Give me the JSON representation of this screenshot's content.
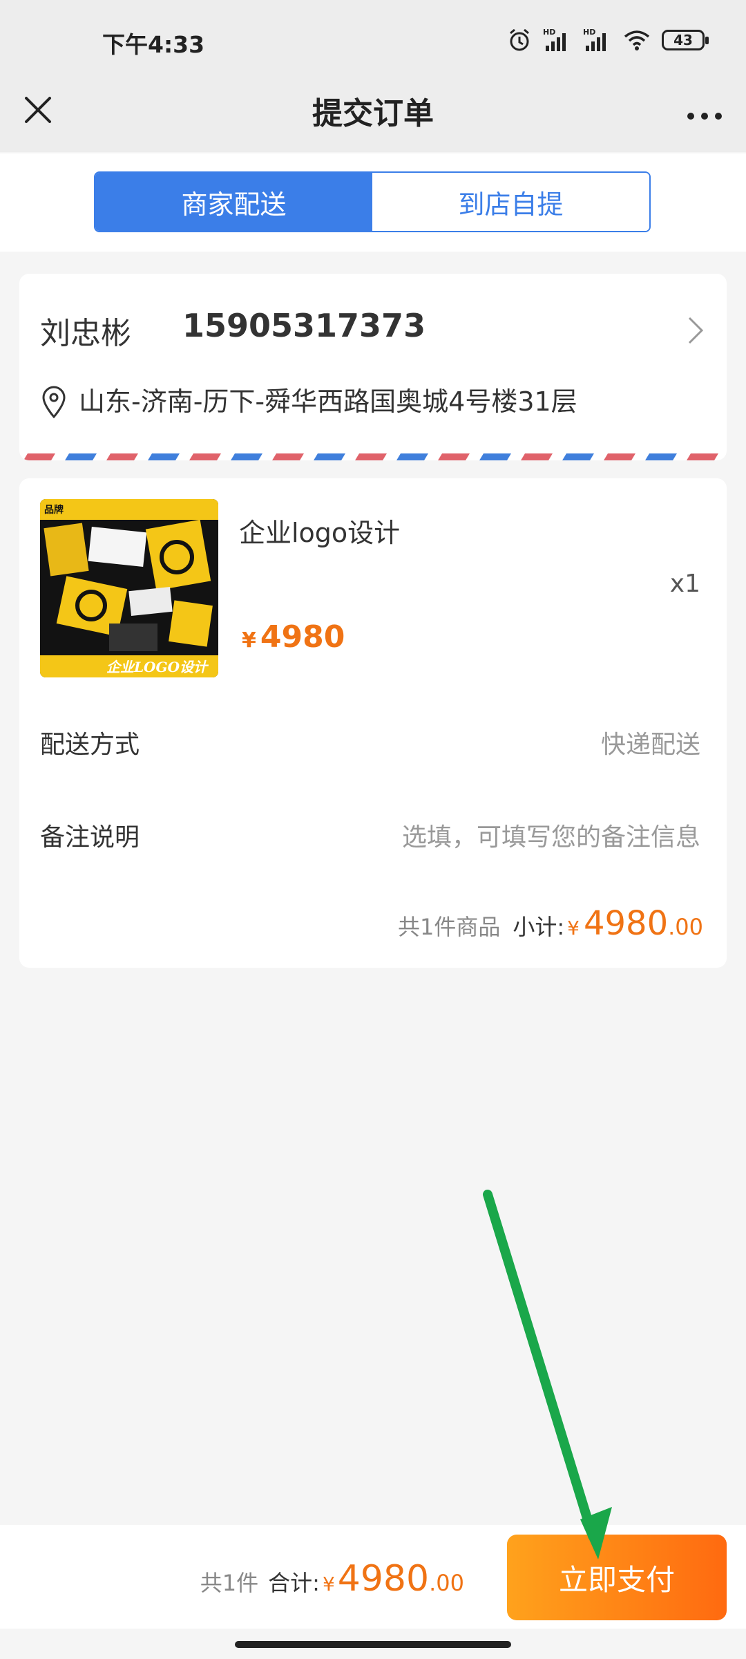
{
  "status_bar": {
    "time": "下午4:33",
    "battery": "43"
  },
  "navbar": {
    "title": "提交订单"
  },
  "delivery_tabs": [
    {
      "label": "商家配送",
      "active": true
    },
    {
      "label": "到店自提",
      "active": false
    }
  ],
  "address": {
    "name": "刘忠彬",
    "phone": "15905317373",
    "location": "山东-济南-历下-舜华西路国奥城4号楼31层"
  },
  "product": {
    "name": "企业logo设计",
    "quantity": "x1",
    "currency": "¥",
    "price": "4980",
    "image_text": "企业LOGO设计",
    "image_badge": "品牌"
  },
  "shipping": {
    "label": "配送方式",
    "value": "快递配送"
  },
  "remark": {
    "label": "备注说明",
    "placeholder": "选填，可填写您的备注信息"
  },
  "subtotal": {
    "count_text": "共1件商品",
    "label": "小计:",
    "currency": "¥",
    "integer": "4980",
    "decimal": ".00"
  },
  "footer": {
    "count_text": "共1件",
    "total_label": "合计:",
    "currency": "¥",
    "integer": "4980",
    "decimal": ".00",
    "pay_button": "立即支付"
  },
  "colors": {
    "primary_blue": "#3b7ee8",
    "price_orange": "#f07314",
    "annotation_green": "#1aa74a"
  }
}
